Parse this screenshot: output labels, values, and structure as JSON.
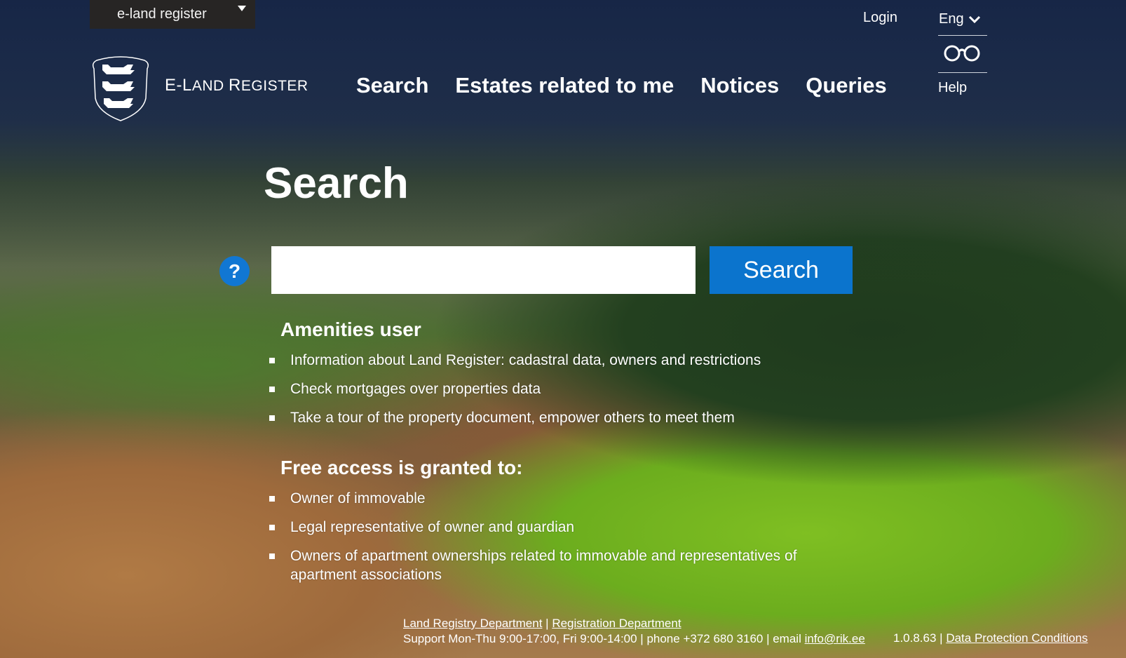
{
  "topbar": {
    "app_switcher_label": "e-land register"
  },
  "header": {
    "brand_first": "E-L",
    "brand_rest1": "AND ",
    "brand_first2": "R",
    "brand_rest2": "EGISTER",
    "nav": [
      {
        "label": "Search"
      },
      {
        "label": "Estates related to me"
      },
      {
        "label": "Notices"
      },
      {
        "label": "Queries"
      }
    ],
    "login_label": "Login",
    "language": "Eng",
    "help_label": "Help"
  },
  "main": {
    "title": "Search",
    "search_input_value": "",
    "search_input_placeholder": "",
    "search_button_label": "Search",
    "help_button_label": "?",
    "sections": [
      {
        "heading": "Amenities user",
        "items": [
          "Information about Land Register: cadastral data, owners and restrictions",
          "Check mortgages over properties data",
          "Take a tour of the property document, empower others to meet them"
        ]
      },
      {
        "heading": "Free access is granted to:",
        "items": [
          "Owner of immovable",
          "Legal representative of owner and guardian",
          "Owners of apartment ownerships related to immovable and representatives of apartment associations"
        ]
      }
    ]
  },
  "footer": {
    "link_land_registry": "Land Registry Department",
    "sep": " | ",
    "link_registration": "Registration Department",
    "support_text": "Support Mon-Thu 9:00-17:00, Fri 9:00-14:00 | phone +372 680 3160 | email ",
    "email": "info@rik.ee",
    "version": "1.0.8.63 | ",
    "link_data_protection": "Data Protection Conditions"
  }
}
